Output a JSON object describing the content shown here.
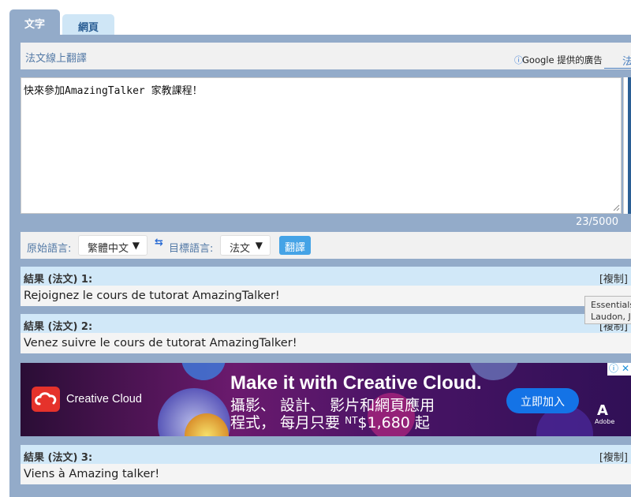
{
  "tabs": [
    {
      "label": "文字",
      "active": true
    },
    {
      "label": "網頁",
      "active": false
    }
  ],
  "header": {
    "title": "法文線上翻譯",
    "ad_label": "Google 提供的廣告",
    "ad_link": "法"
  },
  "input": {
    "text": "快來參加AmazingTalker 家教課程！",
    "counter": "23/5000"
  },
  "languages": {
    "source_label": "原始語言:",
    "source_value": "繁體中文",
    "target_label": "目標語言:",
    "target_value": "法文",
    "translate_button": "翻譯"
  },
  "results": [
    {
      "title": "結果 (法文) 1:",
      "copy": "[複制]",
      "text": "Rejoignez le cours de tutorat AmazingTalker!"
    },
    {
      "title": "結果 (法文) 2:",
      "copy": "[複制]",
      "text": "Venez suivre le cours de tutorat AmazingTalker!"
    },
    {
      "title": "結果 (法文) 3:",
      "copy": "[複制]",
      "text": "Viens à Amazing talker!"
    }
  ],
  "tooltip": {
    "line1": "Essentials",
    "line2": "Laudon, J"
  },
  "banner": {
    "brand": "Creative Cloud",
    "headline": "Make it with Creative Cloud.",
    "line2": "攝影、 設計、 影片和網頁應用",
    "line3_prefix": "程式， 每月只要 ",
    "currency": "NT",
    "price": "$1,680 起",
    "join_button": "立即加入",
    "adobe_mark": "A",
    "adobe_word": "Adobe"
  },
  "colors": {
    "panel": "#93abc9",
    "accent": "#45a3e6",
    "result_header": "#d1e8f8",
    "cc_red": "#e5322b",
    "join_blue": "#1473e6"
  }
}
